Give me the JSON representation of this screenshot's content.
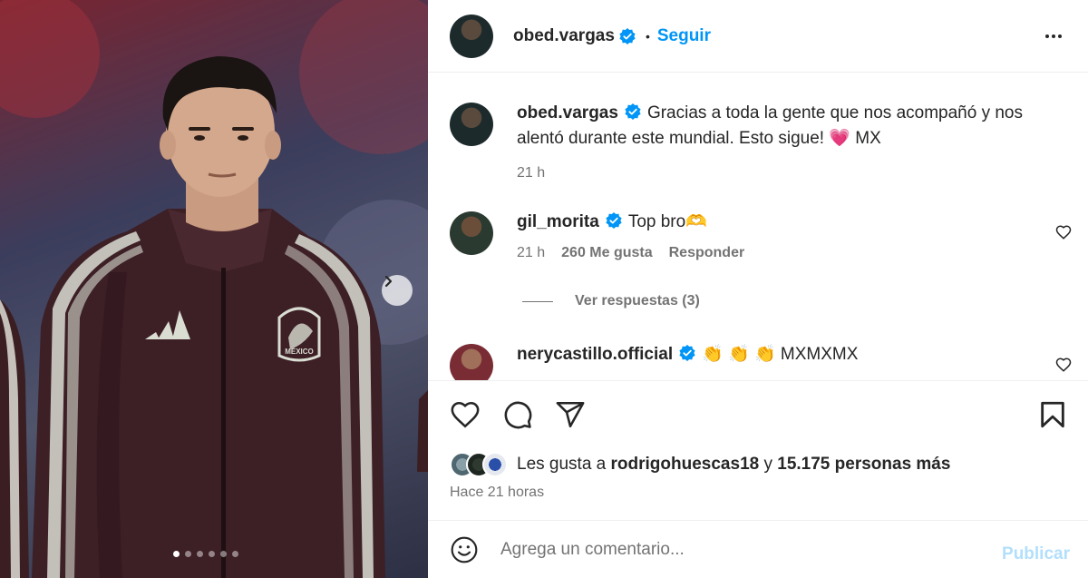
{
  "post": {
    "author": "obed.vargas",
    "follow_label": "Seguir",
    "separator": "•"
  },
  "photo": {
    "badge_text": "MÉXICO",
    "carousel_count": 6,
    "carousel_active": 1,
    "icons": {
      "next": "chevron-right-icon"
    }
  },
  "caption": {
    "username": "obed.vargas",
    "text": "Gracias a toda la gente que nos acompañó y nos alentó durante este mundial. Esto sigue! 💗 MX",
    "time": "21 h"
  },
  "comments": [
    {
      "username": "gil_morita",
      "text": "Top bro🫶",
      "time": "21 h",
      "likes": "260 Me gusta",
      "reply_label": "Responder"
    },
    {
      "username": "nerycastillo.official",
      "text": "👏 👏 👏 MXMXMX"
    }
  ],
  "view_replies_label": "Ver respuestas (3)",
  "likes": {
    "prefix": "Les gusta a",
    "user": "rodrigohuescas18",
    "joiner": "y",
    "others": "15.175 personas más"
  },
  "time_ago": "Hace 21 horas",
  "composer": {
    "placeholder": "Agrega un comentario...",
    "publish_label": "Publicar"
  },
  "colors": {
    "accent": "#0095f6",
    "publish_disabled": "#b2dffc",
    "secondary_text": "#737373",
    "verified": "#0095f6"
  },
  "icons": {
    "like": "heart-icon",
    "comment": "comment-icon",
    "share": "send-icon",
    "save": "bookmark-icon",
    "more": "more-horizontal-icon",
    "emoji": "emoji-icon",
    "verified": "verified-badge-icon"
  }
}
